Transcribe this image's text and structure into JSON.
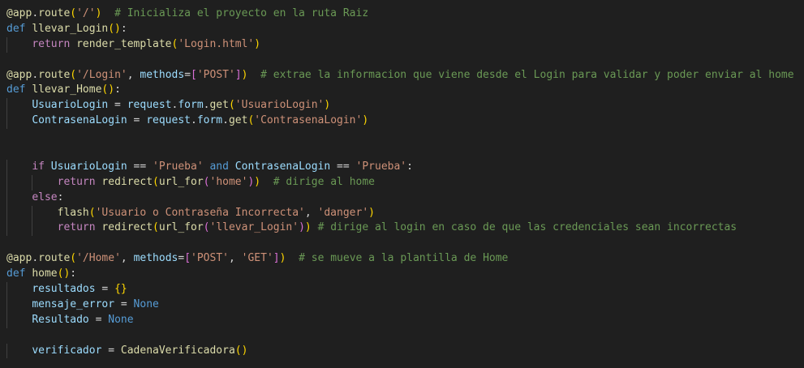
{
  "editor": {
    "language": "python",
    "theme_colors": {
      "background": "#1f1f1f",
      "decorator": "#dcdcaa",
      "keyword": "#569cd6",
      "control": "#c586c0",
      "string": "#ce9178",
      "comment": "#6a9955",
      "variable": "#9cdcfe",
      "bracket_level1": "#ffd700",
      "bracket_level2": "#da70d6",
      "bracket_level3": "#179fff"
    },
    "lines": [
      [
        [
          "decorator",
          "@app"
        ],
        [
          "plain",
          "."
        ],
        [
          "func",
          "route"
        ],
        [
          "bracket1",
          "("
        ],
        [
          "string",
          "'/'"
        ],
        [
          "bracket1",
          ")"
        ],
        [
          "plain",
          "  "
        ],
        [
          "comment",
          "# Inicializa el proyecto en la ruta Raiz"
        ]
      ],
      [
        [
          "keyword",
          "def"
        ],
        [
          "plain",
          " "
        ],
        [
          "func",
          "llevar_Login"
        ],
        [
          "bracket1",
          "()"
        ],
        [
          "plain",
          ":"
        ]
      ],
      [
        [
          "plain",
          "    "
        ],
        [
          "control",
          "return"
        ],
        [
          "plain",
          " "
        ],
        [
          "func",
          "render_template"
        ],
        [
          "bracket1",
          "("
        ],
        [
          "string",
          "'Login.html'"
        ],
        [
          "bracket1",
          ")"
        ]
      ],
      [],
      [
        [
          "decorator",
          "@app"
        ],
        [
          "plain",
          "."
        ],
        [
          "func",
          "route"
        ],
        [
          "bracket1",
          "("
        ],
        [
          "string",
          "'/Login'"
        ],
        [
          "plain",
          ", "
        ],
        [
          "param",
          "methods"
        ],
        [
          "plain",
          "="
        ],
        [
          "bracket2",
          "["
        ],
        [
          "string",
          "'POST'"
        ],
        [
          "bracket2",
          "]"
        ],
        [
          "bracket1",
          ")"
        ],
        [
          "plain",
          "  "
        ],
        [
          "comment",
          "# extrae la informacion que viene desde el Login para validar y poder enviar al home"
        ]
      ],
      [
        [
          "keyword",
          "def"
        ],
        [
          "plain",
          " "
        ],
        [
          "func",
          "llevar_Home"
        ],
        [
          "bracket1",
          "()"
        ],
        [
          "plain",
          ":"
        ]
      ],
      [
        [
          "plain",
          "    "
        ],
        [
          "var",
          "UsuarioLogin"
        ],
        [
          "plain",
          " = "
        ],
        [
          "var",
          "request"
        ],
        [
          "plain",
          "."
        ],
        [
          "var",
          "form"
        ],
        [
          "plain",
          "."
        ],
        [
          "func",
          "get"
        ],
        [
          "bracket1",
          "("
        ],
        [
          "string",
          "'UsuarioLogin'"
        ],
        [
          "bracket1",
          ")"
        ]
      ],
      [
        [
          "plain",
          "    "
        ],
        [
          "var",
          "ContrasenaLogin"
        ],
        [
          "plain",
          " = "
        ],
        [
          "var",
          "request"
        ],
        [
          "plain",
          "."
        ],
        [
          "var",
          "form"
        ],
        [
          "plain",
          "."
        ],
        [
          "func",
          "get"
        ],
        [
          "bracket1",
          "("
        ],
        [
          "string",
          "'ContrasenaLogin'"
        ],
        [
          "bracket1",
          ")"
        ]
      ],
      [],
      [],
      [
        [
          "plain",
          "    "
        ],
        [
          "control",
          "if"
        ],
        [
          "plain",
          " "
        ],
        [
          "var",
          "UsuarioLogin"
        ],
        [
          "plain",
          " == "
        ],
        [
          "string",
          "'Prueba'"
        ],
        [
          "plain",
          " "
        ],
        [
          "keyword",
          "and"
        ],
        [
          "plain",
          " "
        ],
        [
          "var",
          "ContrasenaLogin"
        ],
        [
          "plain",
          " == "
        ],
        [
          "string",
          "'Prueba'"
        ],
        [
          "plain",
          ":"
        ]
      ],
      [
        [
          "plain",
          "        "
        ],
        [
          "control",
          "return"
        ],
        [
          "plain",
          " "
        ],
        [
          "func",
          "redirect"
        ],
        [
          "bracket1",
          "("
        ],
        [
          "func",
          "url_for"
        ],
        [
          "bracket2",
          "("
        ],
        [
          "string",
          "'home'"
        ],
        [
          "bracket2",
          ")"
        ],
        [
          "bracket1",
          ")"
        ],
        [
          "plain",
          "  "
        ],
        [
          "comment",
          "# dirige al home"
        ]
      ],
      [
        [
          "plain",
          "    "
        ],
        [
          "control",
          "else"
        ],
        [
          "plain",
          ":"
        ]
      ],
      [
        [
          "plain",
          "        "
        ],
        [
          "func",
          "flash"
        ],
        [
          "bracket1",
          "("
        ],
        [
          "string",
          "'Usuario o Contraseña Incorrecta'"
        ],
        [
          "plain",
          ", "
        ],
        [
          "string",
          "'danger'"
        ],
        [
          "bracket1",
          ")"
        ]
      ],
      [
        [
          "plain",
          "        "
        ],
        [
          "control",
          "return"
        ],
        [
          "plain",
          " "
        ],
        [
          "func",
          "redirect"
        ],
        [
          "bracket1",
          "("
        ],
        [
          "func",
          "url_for"
        ],
        [
          "bracket2",
          "("
        ],
        [
          "string",
          "'llevar_Login'"
        ],
        [
          "bracket2",
          ")"
        ],
        [
          "bracket1",
          ")"
        ],
        [
          "plain",
          " "
        ],
        [
          "comment",
          "# dirige al login en caso de que las credenciales sean incorrectas"
        ]
      ],
      [],
      [
        [
          "decorator",
          "@app"
        ],
        [
          "plain",
          "."
        ],
        [
          "func",
          "route"
        ],
        [
          "bracket1",
          "("
        ],
        [
          "string",
          "'/Home'"
        ],
        [
          "plain",
          ", "
        ],
        [
          "param",
          "methods"
        ],
        [
          "plain",
          "="
        ],
        [
          "bracket2",
          "["
        ],
        [
          "string",
          "'POST'"
        ],
        [
          "plain",
          ", "
        ],
        [
          "string",
          "'GET'"
        ],
        [
          "bracket2",
          "]"
        ],
        [
          "bracket1",
          ")"
        ],
        [
          "plain",
          "  "
        ],
        [
          "comment",
          "# se mueve a la plantilla de Home"
        ]
      ],
      [
        [
          "keyword",
          "def"
        ],
        [
          "plain",
          " "
        ],
        [
          "func",
          "home"
        ],
        [
          "bracket1",
          "()"
        ],
        [
          "plain",
          ":"
        ]
      ],
      [
        [
          "plain",
          "    "
        ],
        [
          "var",
          "resultados"
        ],
        [
          "plain",
          " = "
        ],
        [
          "bracket1",
          "{}"
        ]
      ],
      [
        [
          "plain",
          "    "
        ],
        [
          "var",
          "mensaje_error"
        ],
        [
          "plain",
          " = "
        ],
        [
          "const",
          "None"
        ]
      ],
      [
        [
          "plain",
          "    "
        ],
        [
          "var",
          "Resultado"
        ],
        [
          "plain",
          " = "
        ],
        [
          "const",
          "None"
        ]
      ],
      [],
      [
        [
          "plain",
          "    "
        ],
        [
          "var",
          "verificador"
        ],
        [
          "plain",
          " = "
        ],
        [
          "func",
          "CadenaVerificadora"
        ],
        [
          "bracket1",
          "()"
        ]
      ]
    ]
  }
}
